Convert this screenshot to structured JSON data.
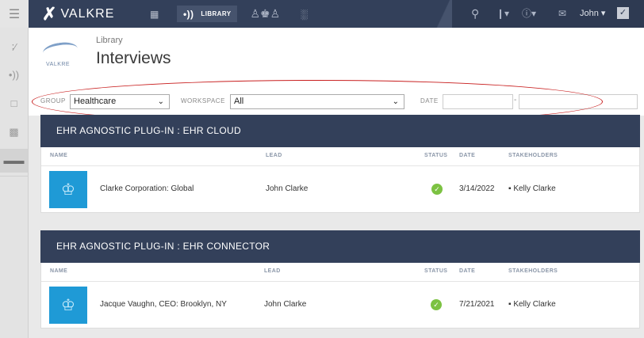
{
  "topbar": {
    "menu_icon": "hamburger-icon",
    "brand": "VALKRE",
    "nav": {
      "library_label": "LIBRARY"
    },
    "user": "John",
    "icons": [
      "grid-icon",
      "broadcast-icon",
      "crown-icon",
      "bar-chart-icon",
      "search-icon",
      "pin-icon",
      "help-icon",
      "messages-icon",
      "check-icon"
    ]
  },
  "sidebar": {
    "items": [
      "mentions-icon",
      "broadcast-icon",
      "comment-icon",
      "org-chart-icon",
      "conversations-icon"
    ]
  },
  "header": {
    "logo_text": "VALKRE",
    "breadcrumb": "Library",
    "title": "Interviews"
  },
  "filters": {
    "group_label": "GROUP",
    "group_value": "Healthcare",
    "workspace_label": "WORKSPACE",
    "workspace_value": "All",
    "date_label": "DATE",
    "date_separator": "-"
  },
  "columns": {
    "name": "NAME",
    "lead": "LEAD",
    "status": "STATUS",
    "date": "DATE",
    "stakeholders": "STAKEHOLDERS"
  },
  "groups": [
    {
      "title": "EHR AGNOSTIC PLUG-IN : EHR CLOUD",
      "rows": [
        {
          "name": "Clarke Corporation: Global",
          "lead": "John Clarke",
          "status": "complete",
          "date": "3/14/2022",
          "stakeholders": "Kelly Clarke"
        }
      ]
    },
    {
      "title": "EHR AGNOSTIC PLUG-IN : EHR CONNECTOR",
      "rows": [
        {
          "name": "Jacque Vaughn, CEO: Brooklyn, NY",
          "lead": "John Clarke",
          "status": "complete",
          "date": "7/21/2021",
          "stakeholders": "Kelly Clarke"
        }
      ]
    }
  ],
  "colors": {
    "topbar": "#33405a",
    "accent_blue": "#1f9ad6",
    "status_green": "#7cc242"
  }
}
